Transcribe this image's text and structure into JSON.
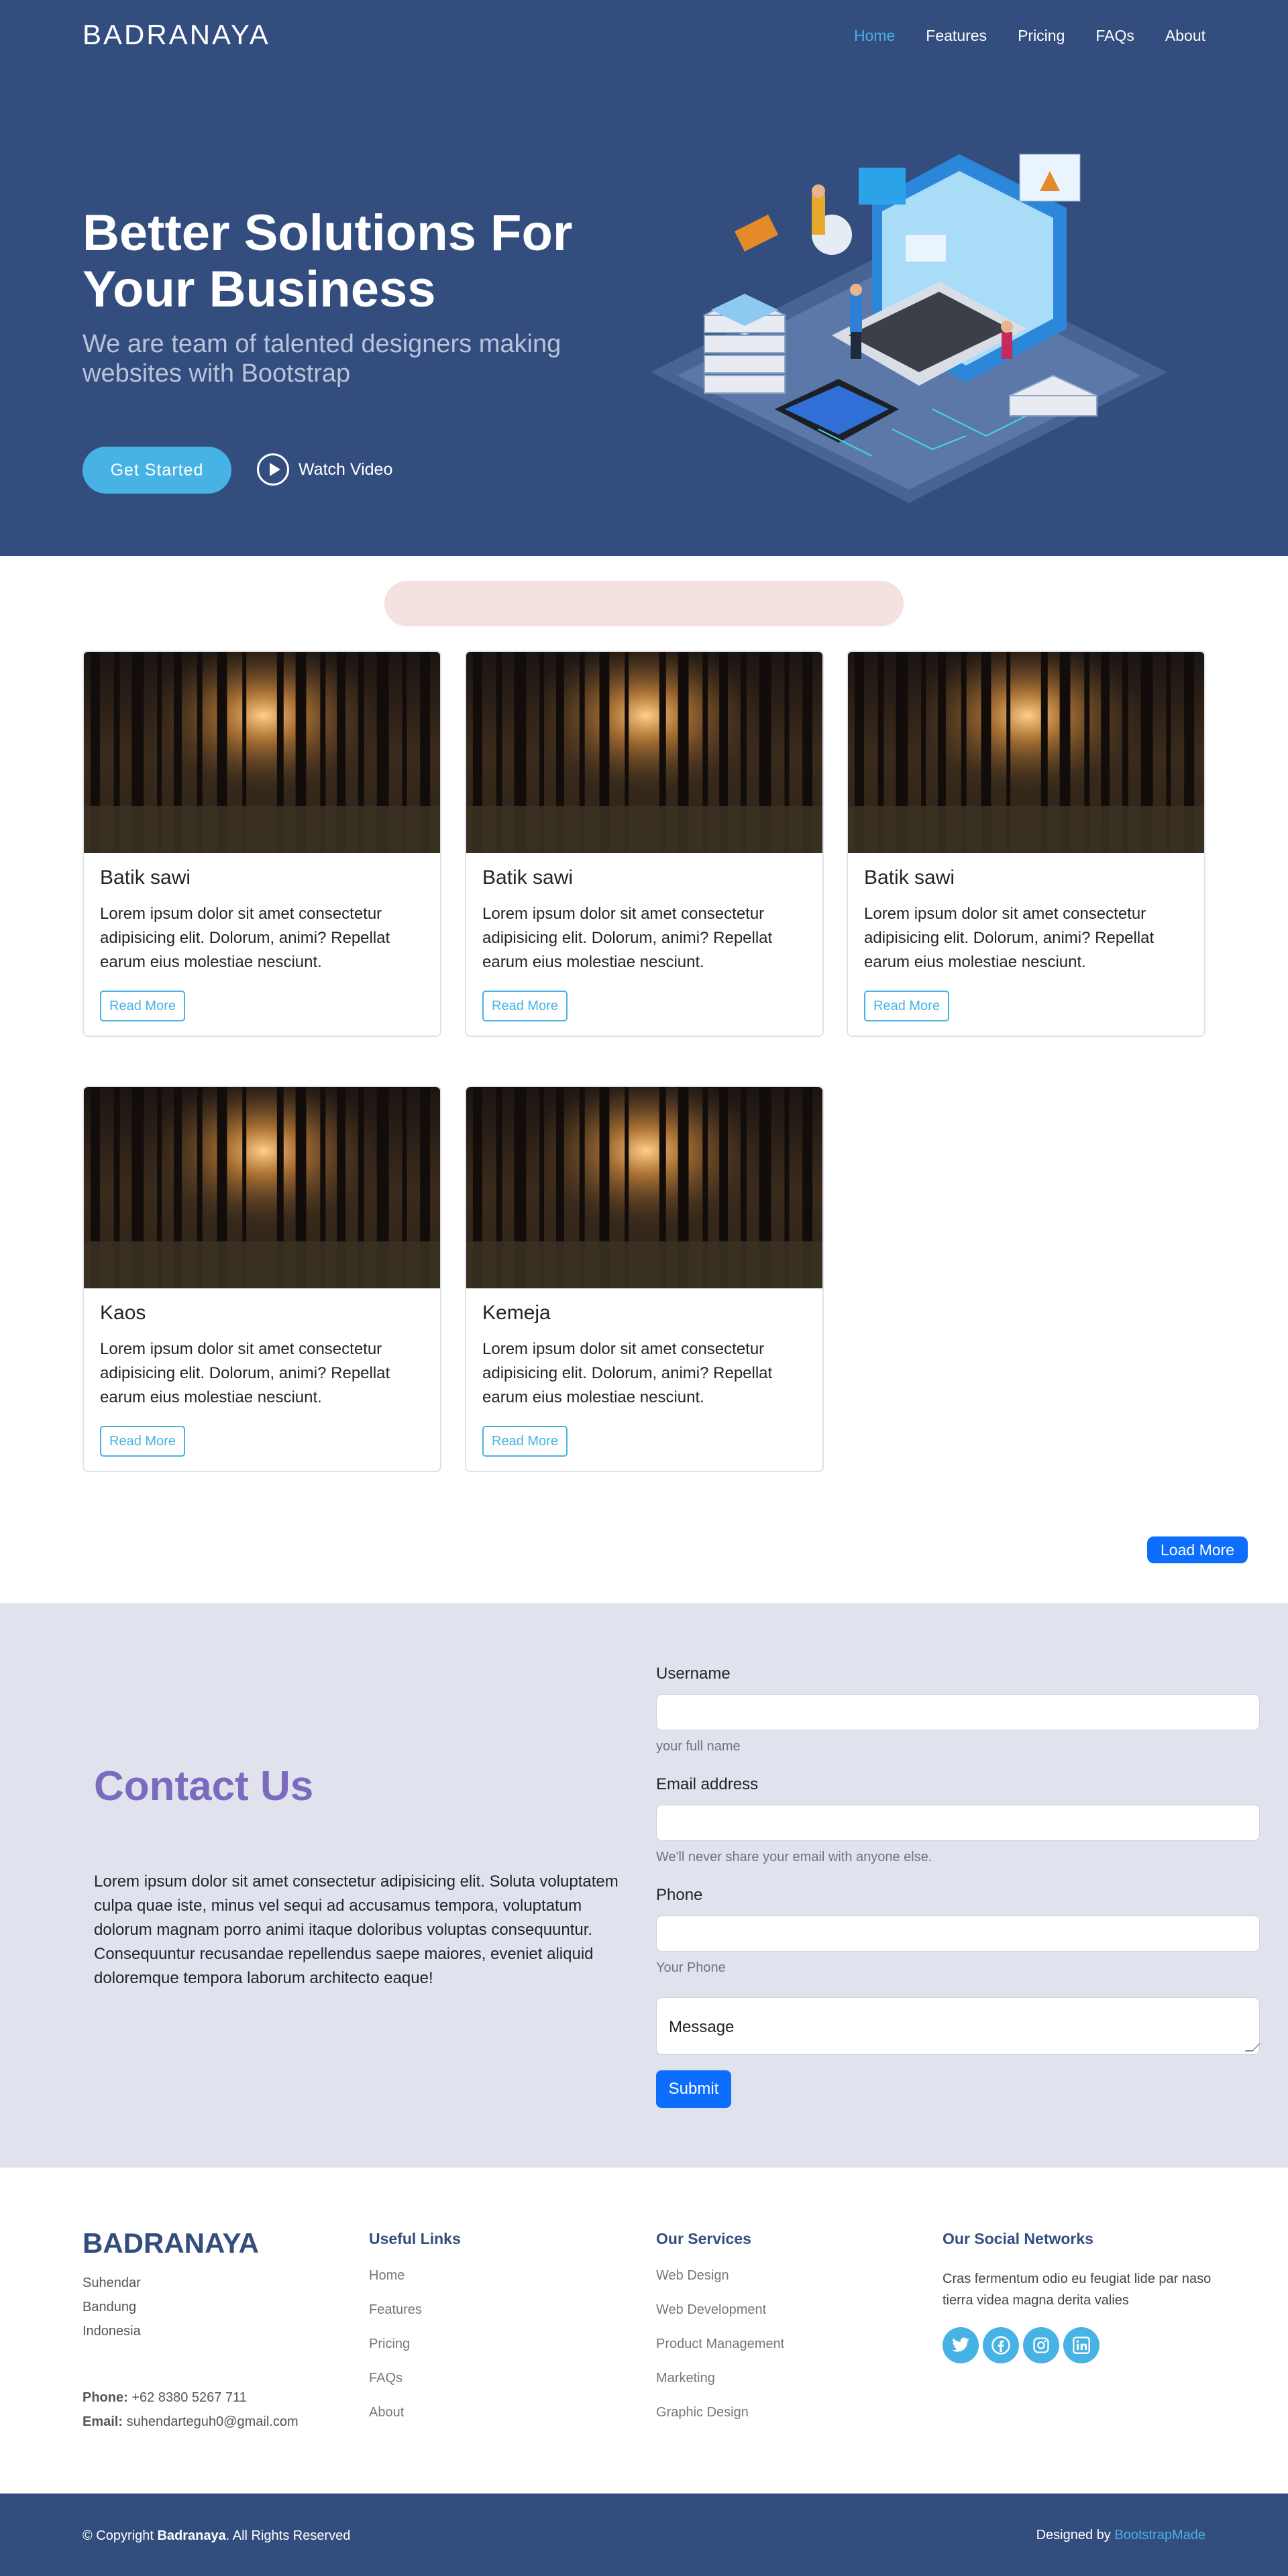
{
  "header": {
    "brand": "BADRANAYA",
    "nav": [
      "Home",
      "Features",
      "Pricing",
      "FAQs",
      "About"
    ],
    "active_nav": "Home"
  },
  "hero": {
    "title": "Better Solutions For Your Business",
    "subtitle": "We are team of talented designers making websites with Bootstrap",
    "cta_label": "Get Started",
    "video_label": "Watch Video"
  },
  "products": {
    "items": [
      {
        "title": "Batik sawi",
        "text": "Lorem ipsum dolor sit amet consectetur adipisicing elit. Dolorum, animi? Repellat earum eius molestiae nesciunt.",
        "button": "Read More"
      },
      {
        "title": "Batik sawi",
        "text": "Lorem ipsum dolor sit amet consectetur adipisicing elit. Dolorum, animi? Repellat earum eius molestiae nesciunt.",
        "button": "Read More"
      },
      {
        "title": "Batik sawi",
        "text": "Lorem ipsum dolor sit amet consectetur adipisicing elit. Dolorum, animi? Repellat earum eius molestiae nesciunt.",
        "button": "Read More"
      },
      {
        "title": "Kaos",
        "text": "Lorem ipsum dolor sit amet consectetur adipisicing elit. Dolorum, animi? Repellat earum eius molestiae nesciunt.",
        "button": "Read More"
      },
      {
        "title": "Kemeja",
        "text": "Lorem ipsum dolor sit amet consectetur adipisicing elit. Dolorum, animi? Repellat earum eius molestiae nesciunt.",
        "button": "Read More"
      }
    ],
    "load_more": "Load More"
  },
  "contact": {
    "title": "Contact Us",
    "text": "Lorem ipsum dolor sit amet consectetur adipisicing elit. Soluta voluptatem culpa quae iste, minus vel sequi ad accusamus tempora, voluptatum dolorum magnam porro animi itaque doloribus voluptas consequuntur. Consequuntur recusandae repellendus saepe maiores, eveniet aliquid doloremque tempora laborum architecto eaque!",
    "username_label": "Username",
    "username_value": "",
    "username_hint": "your full name",
    "email_label": "Email address",
    "email_value": "",
    "email_hint": "We'll never share your email with anyone else.",
    "phone_label": "Phone",
    "phone_value": "",
    "phone_hint": "Your Phone",
    "message_placeholder": "Message",
    "submit_label": "Submit"
  },
  "footer": {
    "brand": "BADRANAYA",
    "address": [
      "Suhendar",
      "Bandung",
      "Indonesia"
    ],
    "phone_label": "Phone:",
    "phone": "+62 8380 5267 711",
    "email_label": "Email:",
    "email": "suhendarteguh0@gmail.com",
    "useful_links_title": "Useful Links",
    "useful_links": [
      "Home",
      "Features",
      "Pricing",
      "FAQs",
      "About"
    ],
    "services_title": "Our Services",
    "services": [
      "Web Design",
      "Web Development",
      "Product Management",
      "Marketing",
      "Graphic Design"
    ],
    "social_title": "Our Social Networks",
    "social_text": "Cras fermentum odio eu feugiat lide par naso tierra videa magna derita valies",
    "social_icons": [
      "twitter-icon",
      "facebook-icon",
      "instagram-icon",
      "linkedin-icon"
    ],
    "copyright_prefix": "© Copyright",
    "copyright_brand": "Badranaya",
    "copyright_suffix": ". All Rights Reserved",
    "designed_by": "Designed by",
    "designer": "BootstrapMade"
  },
  "colors": {
    "primary": "#334e7e",
    "accent": "#47b2e4",
    "button_blue": "#0d6efd",
    "contact_bg": "#e0e3ed",
    "contact_title": "#7b6bbf"
  }
}
